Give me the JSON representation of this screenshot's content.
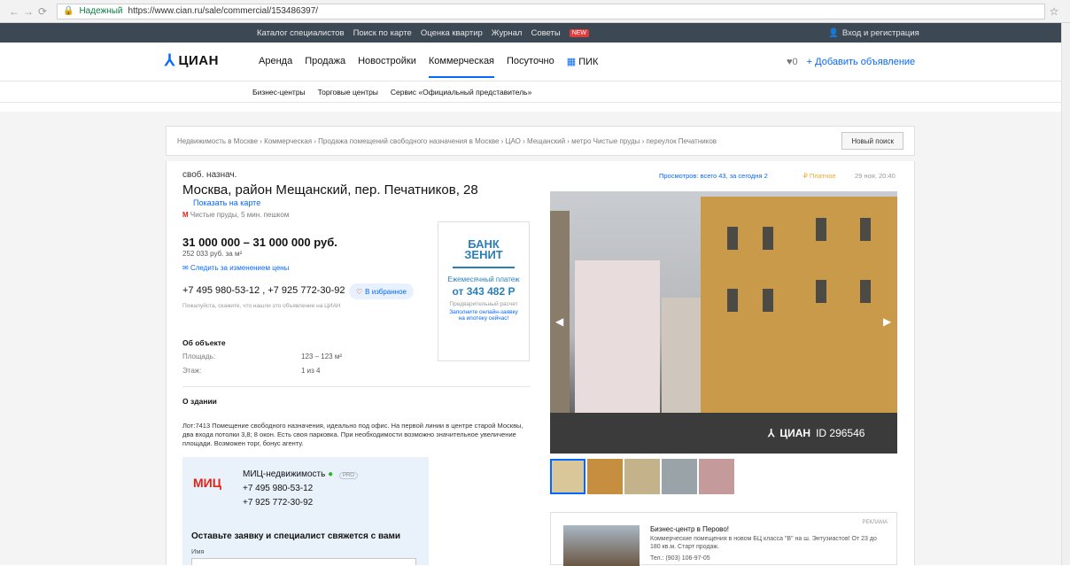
{
  "browser": {
    "secure_label": "Надежный",
    "url": "https://www.cian.ru/sale/commercial/153486397/"
  },
  "topbar": {
    "links": [
      "Каталог специалистов",
      "Поиск по карте",
      "Оценка квартир",
      "Журнал",
      "Советы"
    ],
    "new_badge": "NEW",
    "login": "Вход и регистрация"
  },
  "nav": {
    "logo_text": "ЦИАН",
    "items": [
      "Аренда",
      "Продажа",
      "Новостройки",
      "Коммерческая",
      "Посуточно",
      "ПИК"
    ],
    "favorites_count": "0",
    "add_listing": "+ Добавить объявление"
  },
  "subnav": {
    "items": [
      "Бизнес-центры",
      "Торговые центры",
      "Сервис «Официальный представитель»"
    ]
  },
  "breadcrumbs": "Недвижимость в Москве  ›  Коммерческая  ›  Продажа помещений свободного назначения в Москве  ›  ЦАО  ›  Мещанский  ›  метро Чистые пруды  ›  переулок Печатников",
  "new_search": "Новый поиск",
  "listing": {
    "kind": "своб. назнач.",
    "address": "Москва, район Мещанский, пер. Печатников, 28",
    "map_link": "Показать на карте",
    "metro": "Чистые пруды, 5 мин. пешком",
    "price": "31 000 000 – 31 000 000 руб.",
    "price_per_m2": "252 033 руб. за м²",
    "price_watch": "Следить за изменением цены",
    "phones": "+7 495 980-53-12 , +7 925 772-30-92",
    "favorite_btn": "В избранное",
    "phone_note": "Пожалуйста, скажите, что нашли это объявление на ЦИАН",
    "views": "Просмотров: всего 43, за сегодня 2",
    "paid": "Платное",
    "date": "29 ноя, 20:40",
    "object_heading": "Об объекте",
    "props": [
      {
        "label": "Площадь:",
        "value": "123 – 123 м²"
      },
      {
        "label": "Этаж:",
        "value": "1 из 4"
      }
    ],
    "building_heading": "О здании",
    "description": "Лот:7413 Помещение свободного назначения, идеально под офис. На первой линии в центре старой Москвы, два входа потолки 3,8; 8 окон. Есть своя парковка. При необходимости возможно значительное увеличение площади. Возможен торг, бонус агенту."
  },
  "bank_ad": {
    "logo": "БАНК ЗЕНИТ",
    "line1": "Ежемесячный платеж",
    "amount": "от 343 482 Р",
    "line2": "Предварительный расчет",
    "line3": "Заполните онлайн-заявку на ипотеку сейчас!"
  },
  "agent": {
    "logo": "МИЦ",
    "name": "МИЦ-недвижимость",
    "pro": "PRO",
    "phone1": "+7 495 980-53-12",
    "phone2": "+7 925 772-30-92",
    "form_title": "Оставьте заявку и специалист свяжется с вами",
    "name_label": "Имя"
  },
  "photo": {
    "watermark": "ЦИАН",
    "id_label": "ID 296546"
  },
  "side_ad": {
    "label": "РЕКЛАМА",
    "title": "Бизнес-центр в Перово!",
    "desc": "Коммерческие помещения в новом БЦ класса \"В\" на ш. Энтузиастов! От 23 до 180 кв.м. Старт продаж.",
    "tel": "Тел.: (903) 106-97-05"
  }
}
